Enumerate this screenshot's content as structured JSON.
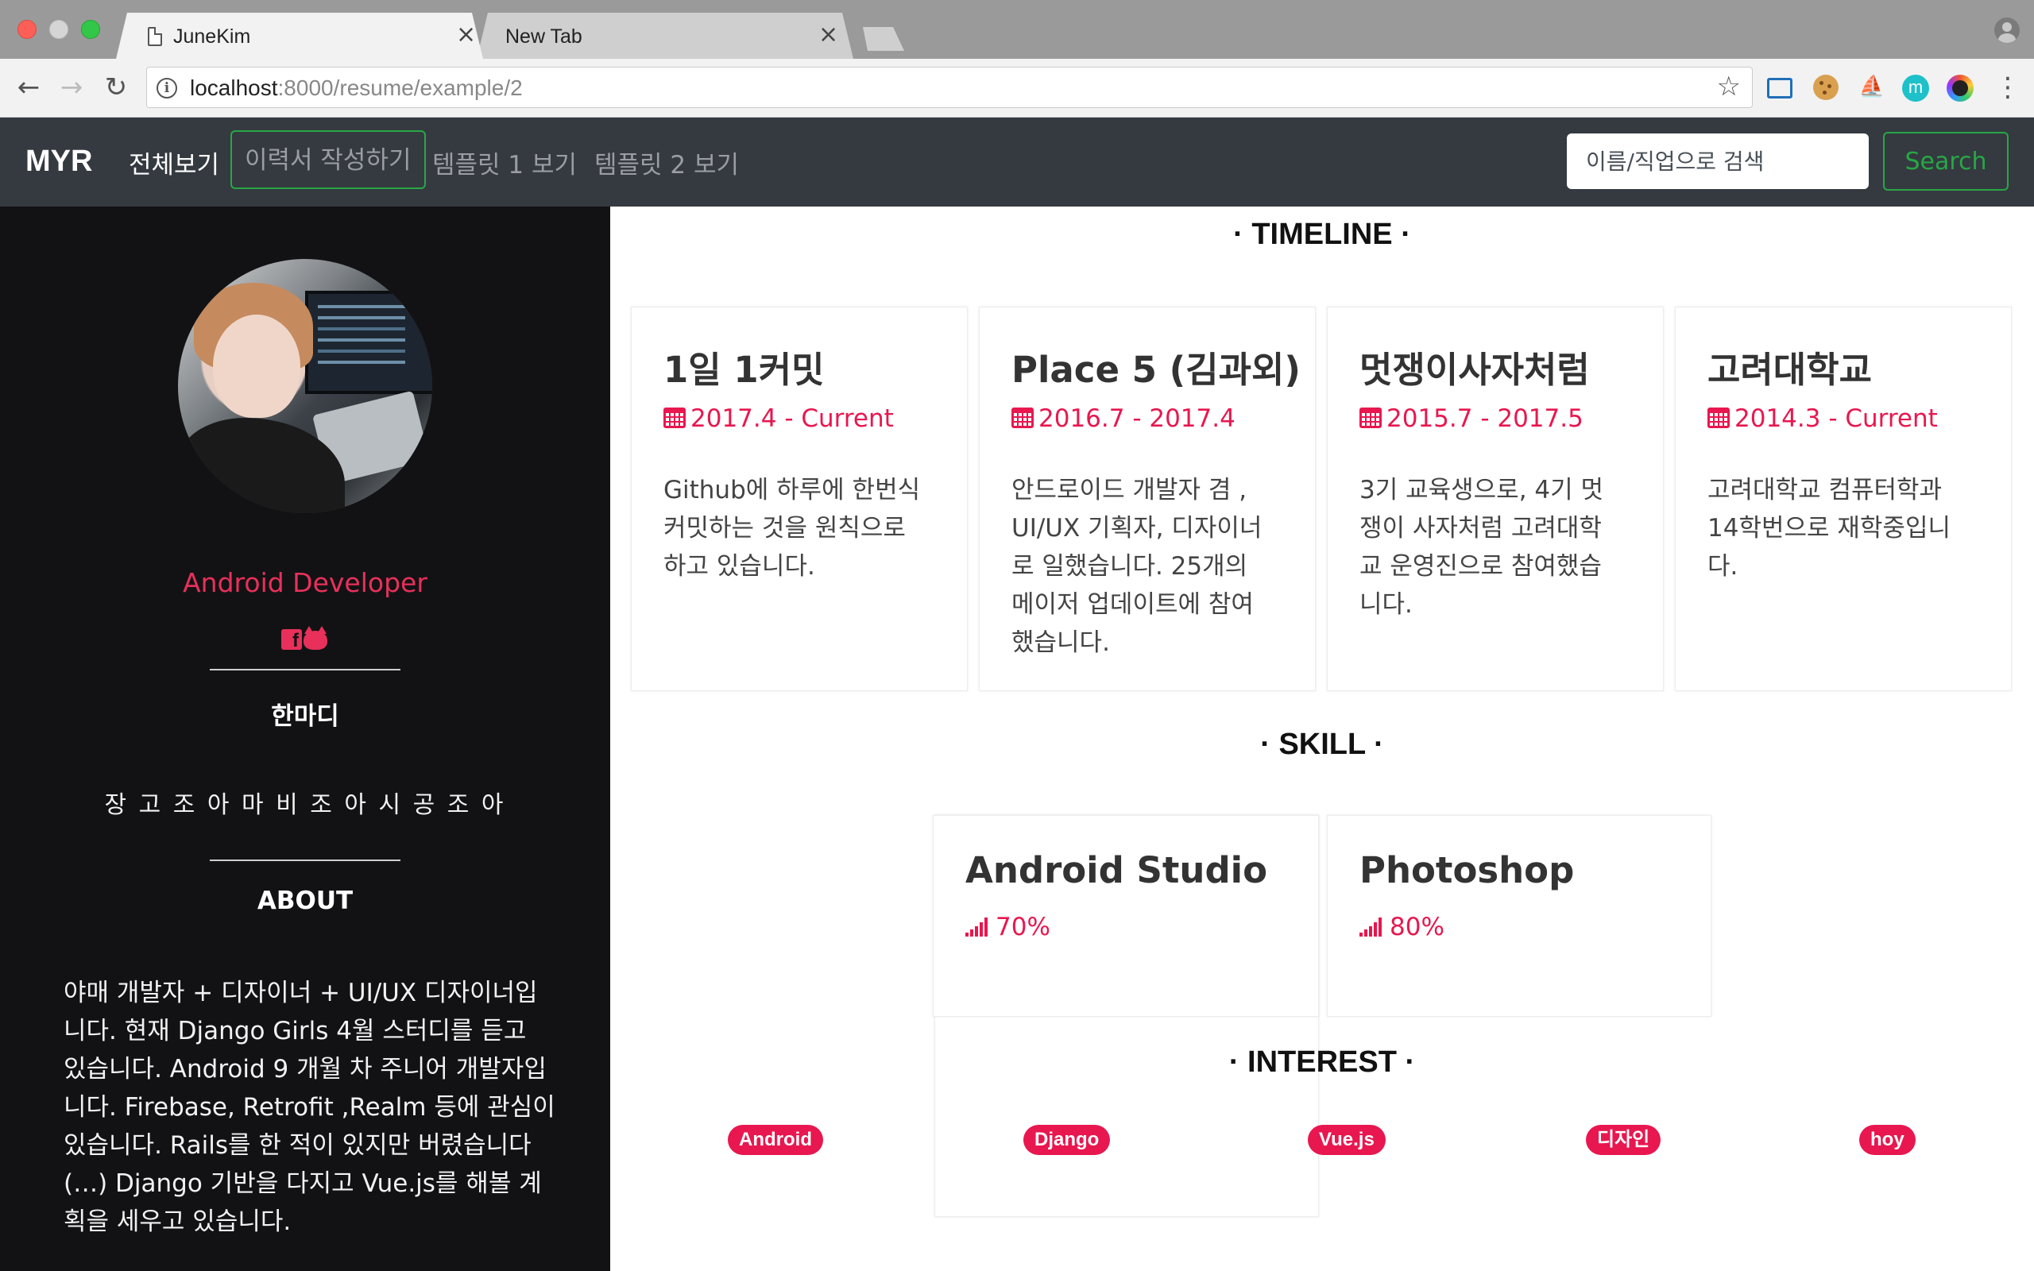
{
  "browser": {
    "tabs": [
      {
        "title": "JuneKim",
        "close": "×"
      },
      {
        "title": "New Tab",
        "close": "×"
      }
    ],
    "url_host": "localhost",
    "url_path": ":8000/resume/example/2",
    "back": "←",
    "forward": "→",
    "reload": "↻",
    "bookmark": "☆",
    "menu": "⋮",
    "extensions": [
      "cast-icon",
      "cookie-icon",
      "boat-icon",
      "m-extension-icon",
      "color-picker-icon"
    ],
    "ext_m_label": "m",
    "ext_boat_glyph": "⛵"
  },
  "navbar": {
    "brand": "MYR",
    "links": [
      "전체보기",
      "이력서 작성하기",
      "템플릿 1 보기",
      "템플릿 2 보기"
    ],
    "search_placeholder": "이름/직업으로 검색",
    "search_button": "Search",
    "accent_color": "#28a745"
  },
  "sidebar": {
    "role": "Android Developer",
    "hanmadi_title": "한마디",
    "hanmadi_text": "장 고 조 아 마 비 조 아 시 공 조 아",
    "about_title": "ABOUT",
    "about_text": "야매 개발자 + 디자이너 + UI/UX 디자이너입니다. 현재 Django Girls 4월 스터디를 듣고 있습니다. Android 9 개월 차 주니어 개발자입니다. Firebase, Retrofit ,Realm 등에 관심이 있습니다. Rails를 한 적이 있지만 버렸습니다 (…) Django 기반을 다지고 Vue.js를 해볼 계획을 세우고 있습니다.",
    "fb_letter": "f"
  },
  "main": {
    "timeline_title": "· TIMELINE ·",
    "timeline": [
      {
        "title": "1일 1커밋",
        "date": "2017.4 - Current",
        "desc": "Github에 하루에 한번식 커밋하는 것을 원칙으로 하고 있습니다."
      },
      {
        "title": "Place 5 (김과외)",
        "date": "2016.7 - 2017.4",
        "desc": "안드로이드 개발자 겸 , UI/UX 기획자, 디자이너로 일했습니다. 25개의 메이저 업데이트에 참여했습니다."
      },
      {
        "title": "멋쟁이사자처럼",
        "date": "2015.7 - 2017.5",
        "desc": "3기 교육생으로, 4기 멋쟁이 사자처럼 고려대학교 운영진으로 참여했습니다."
      },
      {
        "title": "고려대학교",
        "date": "2014.3 - Current",
        "desc": "고려대학교 컴퓨터학과 14학번으로 재학중입니다."
      }
    ],
    "skill_title": "· SKILL ·",
    "skills": [
      {
        "name": "Android Studio",
        "level": "70%"
      },
      {
        "name": "Photoshop",
        "level": "80%"
      }
    ],
    "interest_title": "· INTEREST ·",
    "interests": [
      "Android",
      "Django",
      "Vue.js",
      "디자인",
      "hoy"
    ],
    "accent_color": "#e8174f"
  }
}
